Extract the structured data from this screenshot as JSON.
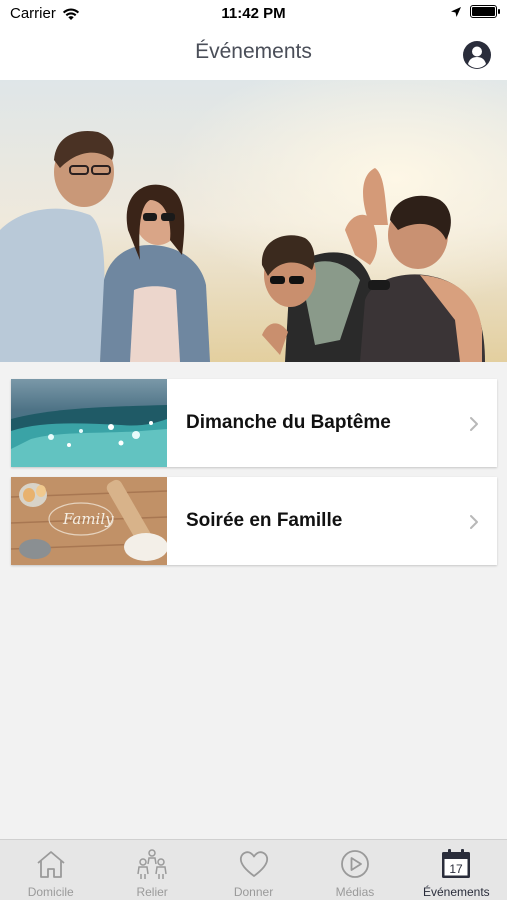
{
  "status_bar": {
    "carrier": "Carrier",
    "time": "11:42 PM"
  },
  "nav": {
    "title": "Événements",
    "profile_icon": "user-circle-icon"
  },
  "hero": {
    "image": "group-of-friends-laughing-photo"
  },
  "events": [
    {
      "title": "Dimanche du Baptême",
      "thumbnail": "water-waves-photo"
    },
    {
      "title": "Soirée en Famille",
      "thumbnail": "family-baking-table-photo"
    }
  ],
  "tabs": [
    {
      "label": "Domicile",
      "icon": "home-icon",
      "active": false
    },
    {
      "label": "Relier",
      "icon": "people-icon",
      "active": false
    },
    {
      "label": "Donner",
      "icon": "heart-icon",
      "active": false
    },
    {
      "label": "Médias",
      "icon": "play-circle-icon",
      "active": false
    },
    {
      "label": "Événements",
      "icon": "calendar-icon",
      "calendar_day": "17",
      "active": true
    }
  ],
  "colors": {
    "nav_title": "#4a4e58",
    "tab_active": "#2a2d3b",
    "tab_inactive": "#9a9a9a",
    "background": "#f2f2f2"
  }
}
